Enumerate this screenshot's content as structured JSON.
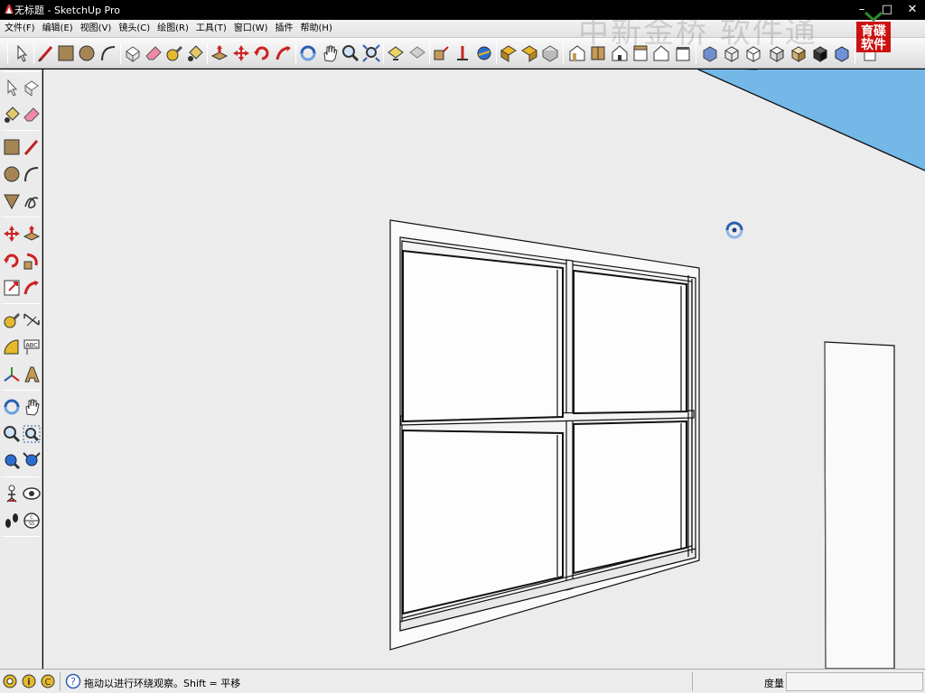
{
  "window": {
    "title": "无标题 - SketchUp Pro",
    "minimize_glyph": "–",
    "maximize_glyph": "□",
    "close_glyph": "✕"
  },
  "menu": [
    {
      "label": "文件(F)"
    },
    {
      "label": "编辑(E)"
    },
    {
      "label": "视图(V)"
    },
    {
      "label": "镜头(C)"
    },
    {
      "label": "绘图(R)"
    },
    {
      "label": "工具(T)"
    },
    {
      "label": "窗口(W)"
    },
    {
      "label": "插件"
    },
    {
      "label": "帮助(H)"
    }
  ],
  "watermark": {
    "text": "中新金桥 软件通",
    "logo_text": "育碟软件"
  },
  "status": {
    "hint": "拖动以进行环绕观察。Shift = 平移",
    "measure_label": "度量",
    "measure_value": ""
  },
  "colors": {
    "sky": "#74b8e8",
    "viewport_bg": "#ececec",
    "accent_red": "#cc1111"
  }
}
